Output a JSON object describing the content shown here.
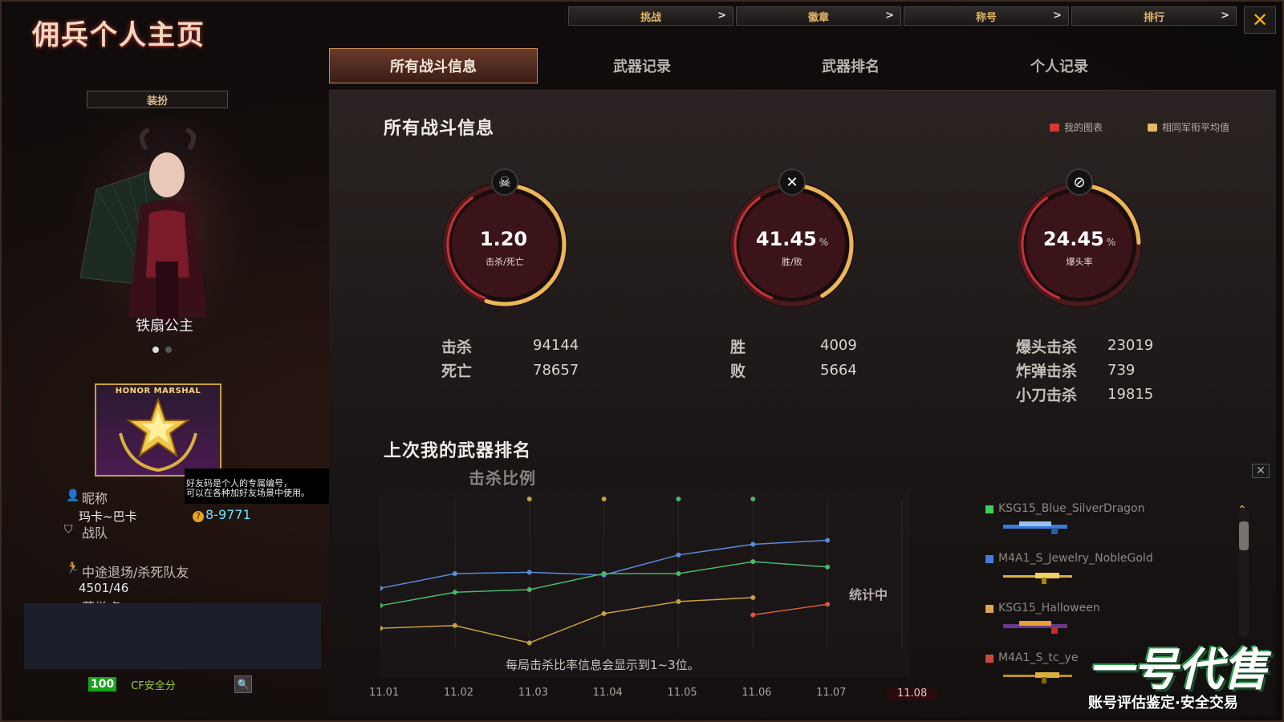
{
  "window": {
    "title": "佣兵个人主页"
  },
  "topnav": [
    {
      "label": "挑战",
      "chevron": ">"
    },
    {
      "label": "徽章",
      "chevron": ">"
    },
    {
      "label": "称号",
      "chevron": ">"
    },
    {
      "label": "排行",
      "chevron": ">"
    }
  ],
  "close_label": "✕",
  "tabs": [
    {
      "label": "所有战斗信息",
      "active": true
    },
    {
      "label": "武器记录",
      "active": false
    },
    {
      "label": "武器排名",
      "active": false
    },
    {
      "label": "个人记录",
      "active": false
    }
  ],
  "sidebar": {
    "outfit_button": "装扮",
    "character_name": "铁扇公主",
    "honor_badge_text": "HONOR MARSHAL",
    "tooltip_line1": "好友码是个人的专属编号，",
    "tooltip_line2": "可以在各种加好友场景中使用。",
    "nickname_label": "昵称",
    "nickname_value": "玛卡~巴卡",
    "friend_code": "8-9771",
    "friend_code_icon": "?",
    "team_label": "战队",
    "quit_label": "中途退场/杀死队友",
    "quit_value": "4501/46",
    "honor_label": "荣誉点",
    "security_score": "100",
    "security_label": "CF安全分",
    "search_icon": "magnifier-icon",
    "search_glyph": "🔍"
  },
  "stats": {
    "section_title": "所有战斗信息",
    "legend": [
      {
        "label": "我的图表",
        "color": "#d23a3a"
      },
      {
        "label": "相同军衔平均值",
        "color": "#e8b86a"
      }
    ],
    "gauges": [
      {
        "value": "1.20",
        "unit": "",
        "sublabel": "击杀/死亡",
        "icon": "skull-icon",
        "glyph": "☠",
        "fraction": 0.55
      },
      {
        "value": "41.45",
        "unit": "%",
        "sublabel": "胜/败",
        "icon": "crossed-guns-icon",
        "glyph": "✕",
        "fraction": 0.4145
      },
      {
        "value": "24.45",
        "unit": "%",
        "sublabel": "爆头率",
        "icon": "headshot-icon",
        "glyph": "⊘",
        "fraction": 0.2445
      }
    ],
    "kd": {
      "kill_label": "击杀",
      "kill_value": "94144",
      "death_label": "死亡",
      "death_value": "78657"
    },
    "wl": {
      "win_label": "胜",
      "win_value": "4009",
      "lose_label": "败",
      "lose_value": "5664"
    },
    "special": {
      "headshot_label": "爆头击杀",
      "headshot_value": "23019",
      "bomb_label": "炸弹击杀",
      "bomb_value": "739",
      "knife_label": "小刀击杀",
      "knife_value": "19815"
    }
  },
  "ranking": {
    "section_title": "上次我的武器排名",
    "subtitle": "击杀比例",
    "status": "统计中",
    "note": "每局击杀比率信息会显示到1~3位。",
    "weapons": [
      {
        "name": "KSG15_Blue_SilverDragon",
        "color": "#3ad25a"
      },
      {
        "name": "M4A1_S_Jewelry_NobleGold",
        "color": "#4a7ad8"
      },
      {
        "name": "KSG15_Halloween",
        "color": "#d8a84a"
      },
      {
        "name": "M4A1_S_tc_ye",
        "color": "#c84a3a"
      }
    ]
  },
  "watermark": {
    "brand": "一号代售",
    "slogan": "账号评估鉴定·安全交易"
  },
  "chart_data": {
    "type": "line",
    "title": "击杀比例",
    "categories": [
      "11.01",
      "11.02",
      "11.03",
      "11.04",
      "11.05",
      "11.06",
      "11.07",
      "11.08"
    ],
    "selected_category": "11.08",
    "series": [
      {
        "color": "#5a8ad8",
        "values": [
          4.5,
          5.6,
          5.7,
          5.5,
          7.0,
          7.8,
          8.1,
          null
        ]
      },
      {
        "color": "#4ab86a",
        "values": [
          3.2,
          4.2,
          4.4,
          5.6,
          5.6,
          6.5,
          6.1,
          null
        ]
      },
      {
        "color": "#c8a040",
        "values": [
          1.5,
          1.7,
          0.4,
          2.6,
          3.5,
          3.8,
          null,
          null
        ]
      },
      {
        "color": "#d85a3a",
        "values": [
          null,
          null,
          null,
          null,
          null,
          2.5,
          3.3,
          null
        ]
      }
    ],
    "top_markers": [
      2,
      3,
      4,
      5
    ],
    "ylim": [
      0,
      10
    ]
  }
}
